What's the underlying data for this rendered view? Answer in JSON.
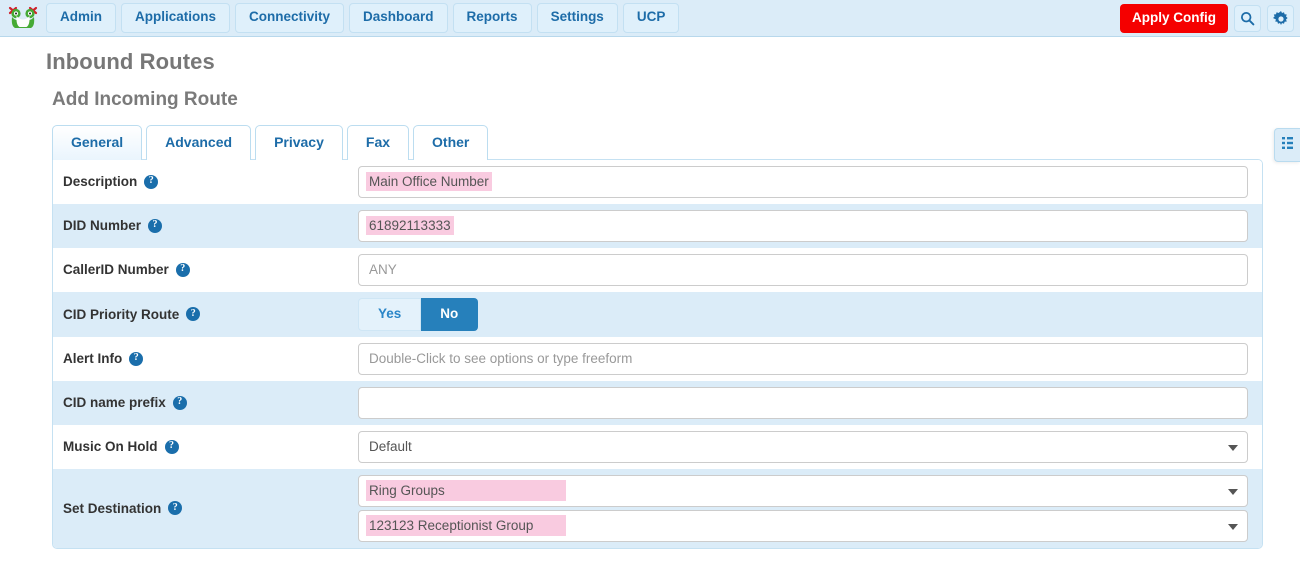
{
  "nav": {
    "logo_icon": "freepbx-frog-logo",
    "items": [
      {
        "label": "Admin"
      },
      {
        "label": "Applications"
      },
      {
        "label": "Connectivity"
      },
      {
        "label": "Dashboard"
      },
      {
        "label": "Reports"
      },
      {
        "label": "Settings"
      },
      {
        "label": "UCP"
      }
    ],
    "apply_config_label": "Apply Config",
    "apply_config_color": "#f50000",
    "search_icon": "search-icon",
    "settings_icon": "gear-icon"
  },
  "page": {
    "title": "Inbound Routes",
    "subtitle": "Add Incoming Route"
  },
  "tabs": [
    {
      "label": "General",
      "active": true
    },
    {
      "label": "Advanced",
      "active": false
    },
    {
      "label": "Privacy",
      "active": false
    },
    {
      "label": "Fax",
      "active": false
    },
    {
      "label": "Other",
      "active": false
    }
  ],
  "form": {
    "description": {
      "label": "Description",
      "value": "Main Office Number",
      "highlighted": true
    },
    "did_number": {
      "label": "DID Number",
      "value": "61892113333",
      "highlighted": true
    },
    "callerid_number": {
      "label": "CallerID Number",
      "value": "",
      "placeholder": "ANY"
    },
    "cid_priority_route": {
      "label": "CID Priority Route",
      "options": [
        "Yes",
        "No"
      ],
      "selected": "No"
    },
    "alert_info": {
      "label": "Alert Info",
      "value": "",
      "placeholder": "Double-Click to see options or type freeform"
    },
    "cid_name_prefix": {
      "label": "CID name prefix",
      "value": "",
      "placeholder": ""
    },
    "music_on_hold": {
      "label": "Music On Hold",
      "value": "Default"
    },
    "set_destination": {
      "label": "Set Destination",
      "module_value": "Ring Groups",
      "target_value": "123123 Receptionist Group",
      "highlighted": true
    }
  },
  "drawer": {
    "icon": "grid-list-icon"
  },
  "colors": {
    "nav_bg": "#dbecf8",
    "accent_blue": "#1d6ca8",
    "row_alt_bg": "#dbecf8",
    "highlight_pink": "#f9cbe0",
    "apply_red": "#f50000"
  }
}
